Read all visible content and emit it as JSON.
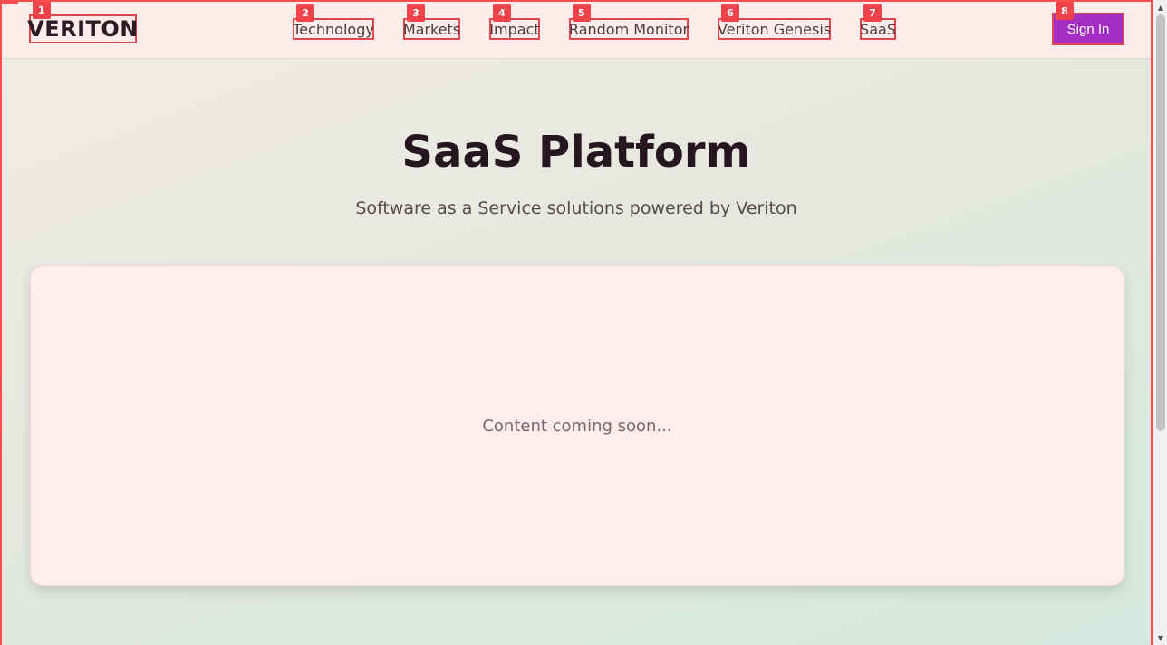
{
  "header": {
    "logo": "VERITON",
    "logo_badge": "1",
    "nav": [
      {
        "label": "Technology",
        "badge": "2"
      },
      {
        "label": "Markets",
        "badge": "3"
      },
      {
        "label": "Impact",
        "badge": "4"
      },
      {
        "label": "Random Monitor",
        "badge": "5"
      },
      {
        "label": "Veriton Genesis",
        "badge": "6"
      },
      {
        "label": "SaaS",
        "badge": "7"
      }
    ],
    "signin_label": "Sign In",
    "signin_badge": "8"
  },
  "hero": {
    "title": "SaaS Platform",
    "subtitle": "Software as a Service solutions powered by Veriton"
  },
  "card": {
    "text": "Content coming soon..."
  },
  "colors": {
    "accent": "#a32ec4",
    "annotation": "#e2464f",
    "header_bg": "#fdecea",
    "card_bg": "#ffeded"
  },
  "icons": {
    "scroll_up": "triangle-up-icon",
    "scroll_down": "triangle-down-icon"
  }
}
